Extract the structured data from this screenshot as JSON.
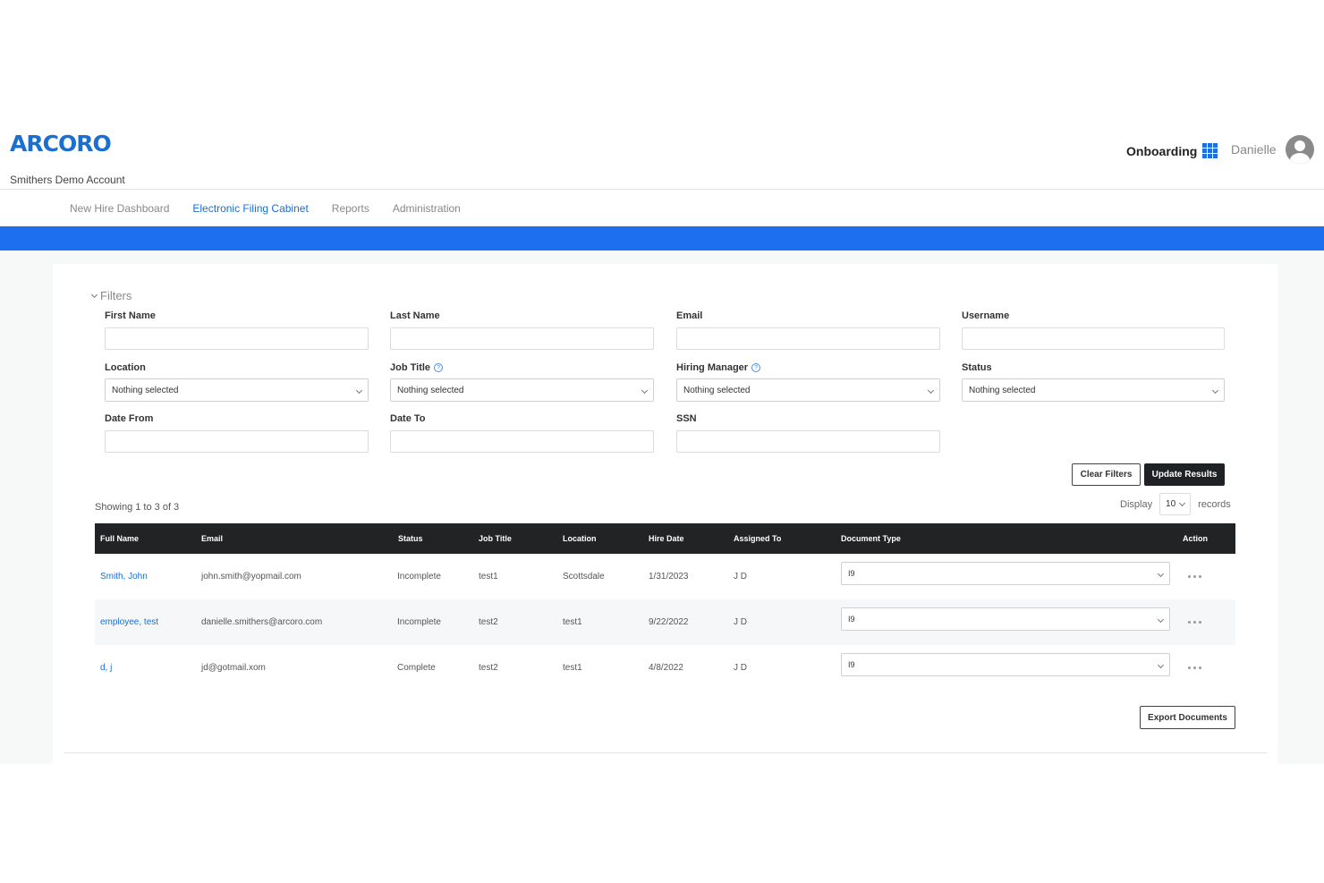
{
  "header": {
    "logo": "ARCORO",
    "account": "Smithers Demo Account",
    "app_name": "Onboarding",
    "user_name": "Danielle"
  },
  "nav": {
    "items": [
      {
        "label": "New Hire Dashboard"
      },
      {
        "label": "Electronic Filing Cabinet",
        "active": true
      },
      {
        "label": "Reports"
      },
      {
        "label": "Administration"
      }
    ]
  },
  "filters": {
    "toggle_label": "Filters",
    "first_name": {
      "label": "First Name",
      "value": ""
    },
    "last_name": {
      "label": "Last Name",
      "value": ""
    },
    "email": {
      "label": "Email",
      "value": ""
    },
    "username": {
      "label": "Username",
      "value": ""
    },
    "location": {
      "label": "Location",
      "value": "Nothing selected"
    },
    "job_title": {
      "label": "Job Title",
      "value": "Nothing selected"
    },
    "hiring_manager": {
      "label": "Hiring Manager",
      "value": "Nothing selected"
    },
    "status": {
      "label": "Status",
      "value": "Nothing selected"
    },
    "date_from": {
      "label": "Date From",
      "value": ""
    },
    "date_to": {
      "label": "Date To",
      "value": ""
    },
    "ssn": {
      "label": "SSN",
      "value": ""
    },
    "help_glyph": "?",
    "clear_label": "Clear Filters",
    "update_label": "Update Results"
  },
  "results": {
    "showing": "Showing 1 to 3 of 3",
    "display_label": "Display",
    "display_value": "10",
    "records_label": "records",
    "columns": [
      "Full Name",
      "Email",
      "Status",
      "Job Title",
      "Location",
      "Hire Date",
      "Assigned To",
      "Document Type",
      "Action"
    ],
    "rows": [
      {
        "full_name": "Smith, John",
        "email": "john.smith@yopmail.com",
        "status": "Incomplete",
        "job_title": "test1",
        "location": "Scottsdale",
        "hire_date": "1/31/2023",
        "assigned_to": "J D",
        "document_type": "I9"
      },
      {
        "full_name": "employee, test",
        "email": "danielle.smithers@arcoro.com",
        "status": "Incomplete",
        "job_title": "test2",
        "location": "test1",
        "hire_date": "9/22/2022",
        "assigned_to": "J D",
        "document_type": "I9"
      },
      {
        "full_name": "d, j",
        "email": "jd@gotmail.xom",
        "status": "Complete",
        "job_title": "test2",
        "location": "test1",
        "hire_date": "4/8/2022",
        "assigned_to": "J D",
        "document_type": "I9"
      }
    ],
    "export_label": "Export Documents"
  },
  "colors": {
    "brand_blue": "#1a6fd1",
    "bar_blue": "#1e6ef0",
    "table_header": "#212325"
  }
}
